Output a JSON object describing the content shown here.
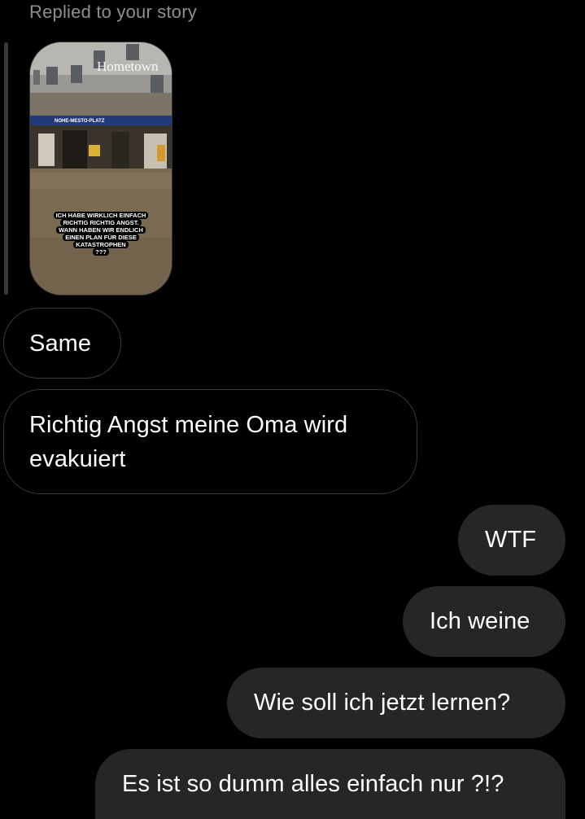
{
  "reply_label": "Replied to your story",
  "story": {
    "watermark": "Hometown",
    "sign_text": "NOHE-MESTO-PLATZ",
    "caption_lines": [
      "ICH HABE WIRKLICH EINFACH",
      "RICHTIG RICHTIG ANGST.",
      "WANN HABEN WIR ENDLICH",
      "EINEN PLAN FÜR DIESE",
      "KATASTROPHEN",
      "???"
    ]
  },
  "messages": [
    {
      "direction": "incoming",
      "text": "Same"
    },
    {
      "direction": "incoming",
      "text": "Richtig Angst meine Oma wird evakuiert"
    },
    {
      "direction": "outgoing",
      "text": "WTF"
    },
    {
      "direction": "outgoing",
      "text": "Ich weine"
    },
    {
      "direction": "outgoing",
      "text": "Wie soll ich jetzt lernen?"
    },
    {
      "direction": "outgoing",
      "text": "Es ist so dumm alles einfach nur ?!?"
    }
  ],
  "colors": {
    "background": "#000000",
    "incoming_border": "#3a3a3a",
    "outgoing_bubble": "#262626",
    "label": "#8e8e8e"
  }
}
